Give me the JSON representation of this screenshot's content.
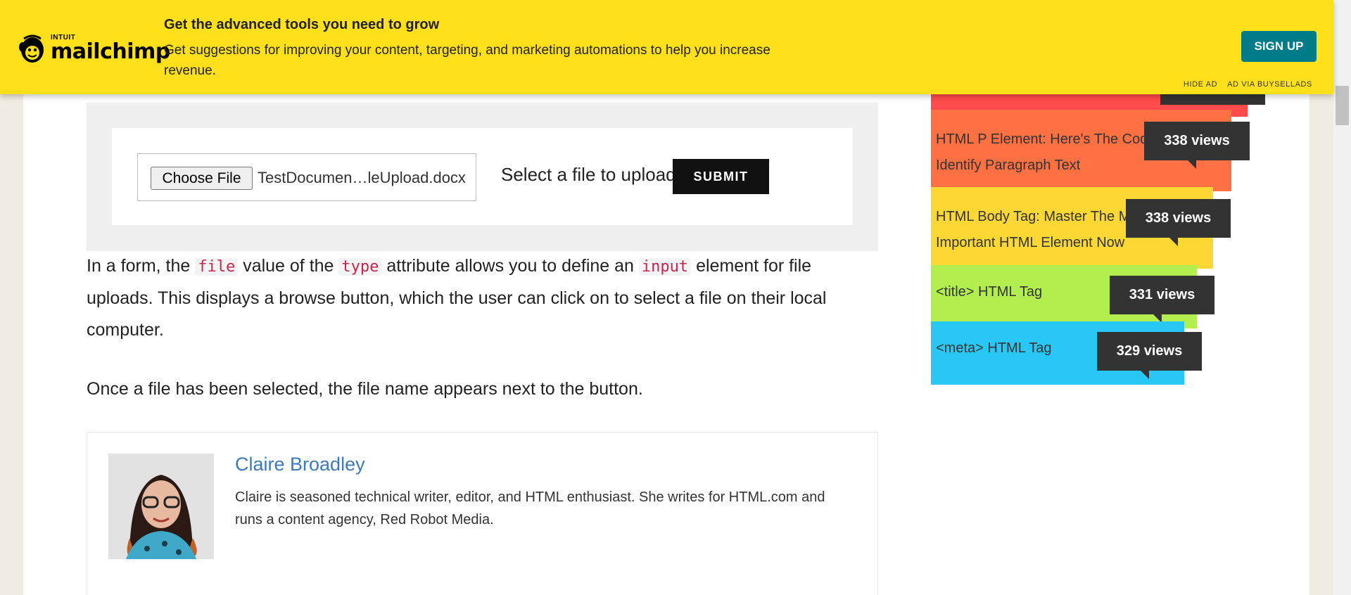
{
  "ad": {
    "brand_small": "INTUIT",
    "brand_big": "mailchimp",
    "headline": "Get the advanced tools you need to grow",
    "body": "Get suggestions for improving your content, targeting, and marketing automations to help you increase revenue.",
    "cta": "SIGN UP",
    "hide": "HIDE AD",
    "via": "AD VIA BUYSELLADS",
    "color": "#ffe01b",
    "cta_color": "#007c89"
  },
  "demo": {
    "choose_button": "Choose File",
    "file_name": "TestDocumen…leUpload.docx",
    "select_label": "Select a file to upload",
    "submit": "SUBMIT"
  },
  "article": {
    "p1_a": "In a form, the",
    "p1_code1": "file",
    "p1_b": "value of the",
    "p1_code2": "type",
    "p1_c": "attribute allows you to define an",
    "p1_code3": "input",
    "p1_d": "element for file uploads. This displays a browse button, which the user can click on to select a file on their local computer.",
    "p2": "Once a file has been selected, the file name appears next to the button."
  },
  "author": {
    "name": "Claire Broadley",
    "bio": "Claire is seasoned technical writer, editor, and HTML enthusiast. She writes for HTML.com and runs a content agency, Red Robot Media."
  },
  "popular": [
    {
      "title_1": "HTML P Element: Here's The Code To",
      "title_2": "Identify Paragraph Text",
      "views": "338 views",
      "color": "#ff7043"
    },
    {
      "title_1": "HTML Body Tag: Master The Most",
      "title_2": "Important HTML Element Now",
      "views": "338 views",
      "color": "#fdd835"
    },
    {
      "title_1": "<title> HTML Tag",
      "title_2": "",
      "views": "331 views",
      "color": "#b2ee4e"
    },
    {
      "title_1": "<meta> HTML Tag",
      "title_2": "",
      "views": "329 views",
      "color": "#29c7f6"
    }
  ]
}
